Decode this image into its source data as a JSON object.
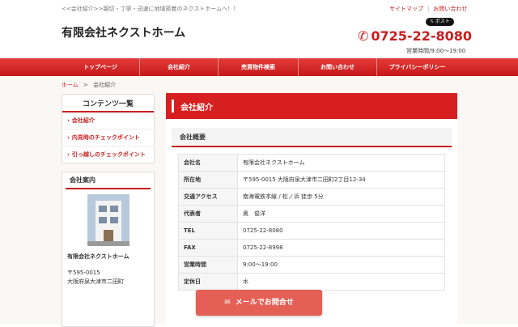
{
  "header": {
    "tagline": "<<会社紹介>>親切・丁寧・迅速に地域密着のネクストホームへ！！",
    "site_title": "有限会社ネクストホーム",
    "links": [
      "サイトマップ",
      "お問い合わせ"
    ],
    "post_button": "ポスト",
    "phone": "0725-22-8080",
    "hours": "営業時間/9:00～19:00"
  },
  "nav": {
    "items": [
      "トップページ",
      "会社紹介",
      "売買物件検索",
      "お問い合わせ",
      "プライバシーポリシー"
    ]
  },
  "breadcrumb": {
    "home": "ホーム",
    "sep": ">",
    "current": "会社紹介"
  },
  "sidebar": {
    "contents_title": "コンテンツ一覧",
    "contents": [
      "会社紹介",
      "内見時のチェックポイント",
      "引っ越しのチェックポイント"
    ],
    "about_title": "会社案内",
    "company_name": "有限会社ネクストホーム",
    "postal": "〒595-0015",
    "address_partial": "大阪府泉大津市二田町"
  },
  "main": {
    "title": "会社紹介",
    "section_title": "会社概要",
    "rows": [
      {
        "key": "会社名",
        "value": "有限会社ネクストホーム"
      },
      {
        "key": "所在地",
        "value": "〒595-0015 大阪府泉大津市二田町2丁目12-34"
      },
      {
        "key": "交通アクセス",
        "value": "南海電鉄本線 / 松ノ浜 徒歩 5分"
      },
      {
        "key": "代表者",
        "value": "奥　俊洋"
      },
      {
        "key": "TEL",
        "value": "0725-22-8080"
      },
      {
        "key": "FAX",
        "value": "0725-22-8998"
      },
      {
        "key": "営業時間",
        "value": "9:00～19:00"
      },
      {
        "key": "定休日",
        "value": "水"
      }
    ]
  },
  "cta": {
    "label": "メールでお問合せ"
  },
  "colors": {
    "accent": "#c81e1e",
    "cta": "#e45f55"
  }
}
